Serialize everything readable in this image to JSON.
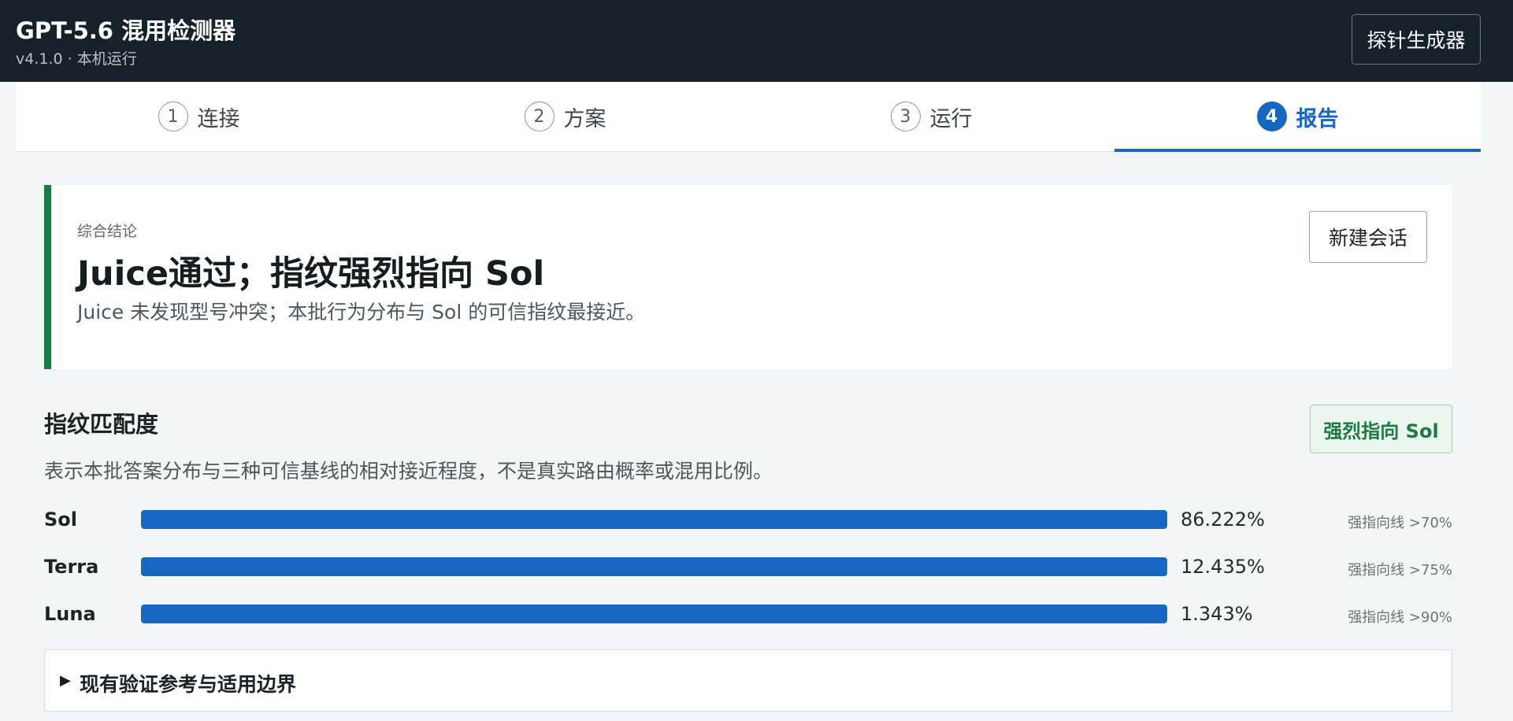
{
  "header": {
    "title": "GPT-5.6 混用检测器",
    "subtitle": "v4.1.0 · 本机运行",
    "probe_button": "探针生成器"
  },
  "steps": [
    {
      "num": "1",
      "label": "连接",
      "active": false
    },
    {
      "num": "2",
      "label": "方案",
      "active": false
    },
    {
      "num": "3",
      "label": "运行",
      "active": false
    },
    {
      "num": "4",
      "label": "报告",
      "active": true
    }
  ],
  "verdict": {
    "kicker": "综合结论",
    "title": "Juice通过；指纹强烈指向 Sol",
    "description": "Juice 未发现型号冲突；本批行为分布与 Sol 的可信指纹最接近。",
    "new_session_button": "新建会话",
    "accent_color": "#1d7a43"
  },
  "fingerprint": {
    "title": "指纹匹配度",
    "description": "表示本批答案分布与三种可信基线的相对接近程度，不是真实路由概率或混用比例。",
    "badge": "强烈指向 Sol",
    "bar_color": "#1766c2",
    "rows": [
      {
        "name": "Sol",
        "percent": "86.222%",
        "fill": 100,
        "threshold": "强指向线 >70%"
      },
      {
        "name": "Terra",
        "percent": "12.435%",
        "fill": 100,
        "threshold": "强指向线 >75%"
      },
      {
        "name": "Luna",
        "percent": "1.343%",
        "fill": 100,
        "threshold": "强指向线 >90%"
      }
    ]
  },
  "details": {
    "label": "现有验证参考与适用边界",
    "icon": "triangle-right-icon"
  }
}
